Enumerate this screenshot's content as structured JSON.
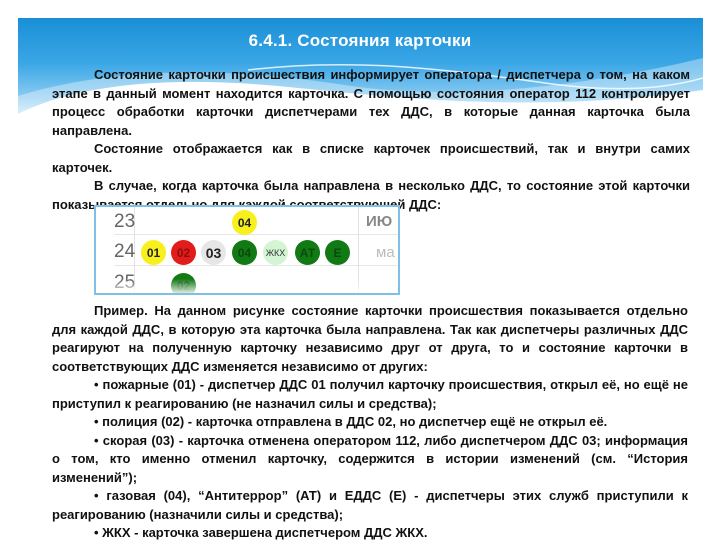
{
  "slide": {
    "title": "6.4.1. Состояния карточки",
    "intro_paragraphs": [
      "Состояние карточки происшествия информирует оператора / диспетчера о том, на каком этапе в данный момент находится карточка. С помощью состояния оператор 112 контролирует процесс обработки карточки диспетчерами тех ДДС, в которые данная карточка была направлена.",
      "Состояние отображается как в списке карточек происшествий, так и внутри самих карточек.",
      "В случае, когда карточка была направлена в несколько ДДС, то состояние этой карточки показывается отдельно для каждой соответствующей ДДС:"
    ],
    "example_paragraphs": [
      "Пример. На данном рисунке состояние карточки происшествия показывается отдельно для каждой ДДС, в которую эта карточка была направлена. Так как диспетчеры различных ДДС реагируют на полученную карточку независимо друг от друга, то и состояние карточки в соответствующих ДДС изменяется независимо от других:",
      "• пожарные (01) - диспетчер ДДС 01 получил карточку происшествия, открыл её, но ещё не приступил к реагированию (не назначил силы и средства);",
      "• полиция (02) - карточка отправлена в ДДС 02, но диспетчер ещё не открыл её.",
      "• скорая (03) - карточка отменена оператором 112, либо диспетчером ДДС 03; информация о том, кто именно отменил карточку, содержится в истории изменений (см. “История изменений”);",
      "• газовая (04), “Антитеррор” (АТ) и ЕДДС (Е) - диспетчеры этих служб приступили к реагированию (назначили силы и средства);",
      "• ЖКХ - карточка завершена диспетчером ДДС ЖКХ."
    ]
  },
  "status_strip": {
    "rows": [
      {
        "number": "23",
        "month": "ИЮ",
        "badges": [
          {
            "label": "04",
            "status": "opened",
            "bg": "#f7f01c",
            "fg": "#222222"
          }
        ]
      },
      {
        "number": "24",
        "month": "ма",
        "badges": [
          {
            "label": "01",
            "status": "opened",
            "bg": "#f7f01c",
            "fg": "#222222"
          },
          {
            "label": "02",
            "status": "sent",
            "bg": "#e21b1b",
            "fg": "#8a0f0f"
          },
          {
            "label": "03",
            "status": "cancelled",
            "bg": "#e6e6e6",
            "fg": "#222222"
          },
          {
            "label": "04",
            "status": "in-progress",
            "bg": "#127a14",
            "fg": "#0a4a0b"
          },
          {
            "label": "ЖКХ",
            "status": "completed",
            "bg": "#d3f5d3",
            "fg": "#333333"
          },
          {
            "label": "АТ",
            "status": "in-progress",
            "bg": "#127a14",
            "fg": "#0a4a0b"
          },
          {
            "label": "Е",
            "status": "in-progress",
            "bg": "#127a14",
            "fg": "#0a4a0b"
          }
        ]
      },
      {
        "number": "25",
        "month": "",
        "badges": [
          {
            "label": "02",
            "status": "in-progress",
            "bg": "#127a14",
            "fg": "#0a4a0b"
          }
        ]
      }
    ]
  },
  "colors": {
    "header_blue": "#1a8fd6",
    "strip_border": "#7fc1e6"
  }
}
